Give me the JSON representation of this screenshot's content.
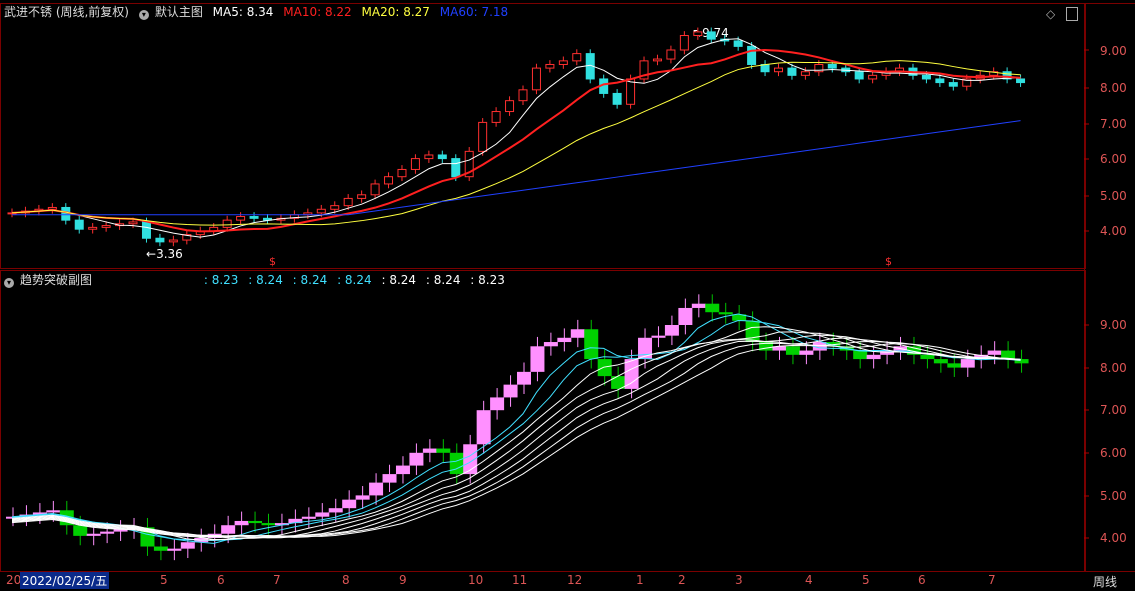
{
  "main": {
    "stock_title": "武进不锈 (周线,前复权)",
    "indicator_name": "默认主图",
    "ma": [
      {
        "label": "MA5: 8.34",
        "color": "#ffffff"
      },
      {
        "label": "MA10: 8.22",
        "color": "#ff2020"
      },
      {
        "label": "MA20: 8.27",
        "color": "#ffff40"
      },
      {
        "label": "MA60: 7.18",
        "color": "#2040ff"
      }
    ],
    "high_label": "9.74",
    "low_label": "3.36",
    "y_ticks": [
      "9.00",
      "8.00",
      "7.00",
      "6.00",
      "5.00",
      "4.00"
    ],
    "markers": [
      "$",
      "$"
    ]
  },
  "sub": {
    "title": "趋势突破副图",
    "values": [
      {
        "label": ": 8.23",
        "color": "#40e0ff"
      },
      {
        "label": ": 8.24",
        "color": "#40e0ff"
      },
      {
        "label": ": 8.24",
        "color": "#40e0ff"
      },
      {
        "label": ": 8.24",
        "color": "#40e0ff"
      },
      {
        "label": ": 8.24",
        "color": "#ffffff"
      },
      {
        "label": ": 8.24",
        "color": "#ffffff"
      },
      {
        "label": ": 8.23",
        "color": "#ffffff"
      }
    ],
    "y_ticks": [
      "9.00",
      "8.00",
      "7.00",
      "6.00",
      "5.00",
      "4.00"
    ]
  },
  "xaxis": {
    "first": "20",
    "date": "2022/02/25/五",
    "months": [
      "5",
      "6",
      "7",
      "8",
      "9",
      "10",
      "11",
      "12",
      "1",
      "2",
      "3",
      "4",
      "5",
      "6",
      "7"
    ],
    "period": "周线"
  },
  "colors": {
    "up": "#ff3030",
    "down": "#30e0e0",
    "frame": "#7a0000",
    "pink": "#ff90ff",
    "green": "#00e000"
  }
}
